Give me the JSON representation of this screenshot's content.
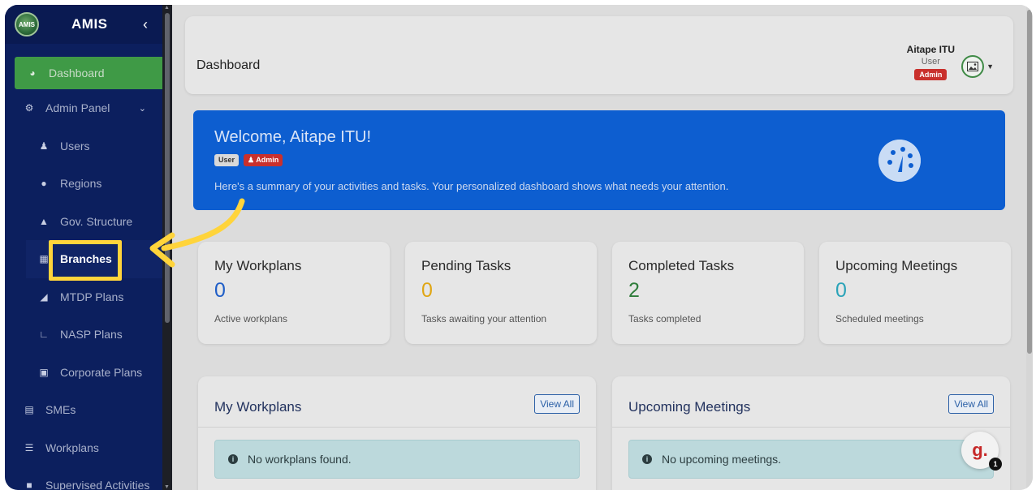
{
  "brand": {
    "name": "AMIS",
    "logo_text": "AMIS"
  },
  "sidebar": {
    "items": [
      {
        "label": "Dashboard",
        "icon": "gauge-icon"
      },
      {
        "label": "Admin Panel",
        "icon": "gear-icon"
      },
      {
        "label": "Users",
        "icon": "users-icon"
      },
      {
        "label": "Regions",
        "icon": "map-pin-icon"
      },
      {
        "label": "Gov. Structure",
        "icon": "sitemap-icon"
      },
      {
        "label": "Branches",
        "icon": "building-icon"
      },
      {
        "label": "MTDP Plans",
        "icon": "project-diagram-icon"
      },
      {
        "label": "NASP Plans",
        "icon": "chart-line-icon"
      },
      {
        "label": "Corporate Plans",
        "icon": "briefcase-icon"
      },
      {
        "label": "SMEs",
        "icon": "box-icon"
      },
      {
        "label": "Workplans",
        "icon": "tasks-icon"
      },
      {
        "label": "Supervised Activities",
        "icon": "lock-icon"
      }
    ]
  },
  "header": {
    "title": "Dashboard",
    "user_name": "Aitape ITU",
    "user_role": "User",
    "user_badge": "Admin"
  },
  "welcome": {
    "title": "Welcome, Aitape ITU!",
    "badge_user": "User",
    "badge_admin": "Admin",
    "description": "Here's a summary of your activities and tasks. Your personalized dashboard shows what needs your attention."
  },
  "stats": [
    {
      "label": "My Workplans",
      "value": "0",
      "sub": "Active workplans",
      "color": "#1f5ec7"
    },
    {
      "label": "Pending Tasks",
      "value": "0",
      "sub": "Tasks awaiting your attention",
      "color": "#e0a614"
    },
    {
      "label": "Completed Tasks",
      "value": "2",
      "sub": "Tasks completed",
      "color": "#2f7d3b"
    },
    {
      "label": "Upcoming Meetings",
      "value": "0",
      "sub": "Scheduled meetings",
      "color": "#2aa3b8"
    }
  ],
  "panels": [
    {
      "title": "My Workplans",
      "view_all": "View All",
      "empty": "No workplans found."
    },
    {
      "title": "Upcoming Meetings",
      "view_all": "View All",
      "empty": "No upcoming meetings."
    }
  ],
  "fab": {
    "label": "g.",
    "count": "1"
  },
  "colors": {
    "sidebar": "#0c1f5e",
    "active": "#3f9a46",
    "highlight": "#ffd43b",
    "welcome": "#0d5ed0"
  }
}
